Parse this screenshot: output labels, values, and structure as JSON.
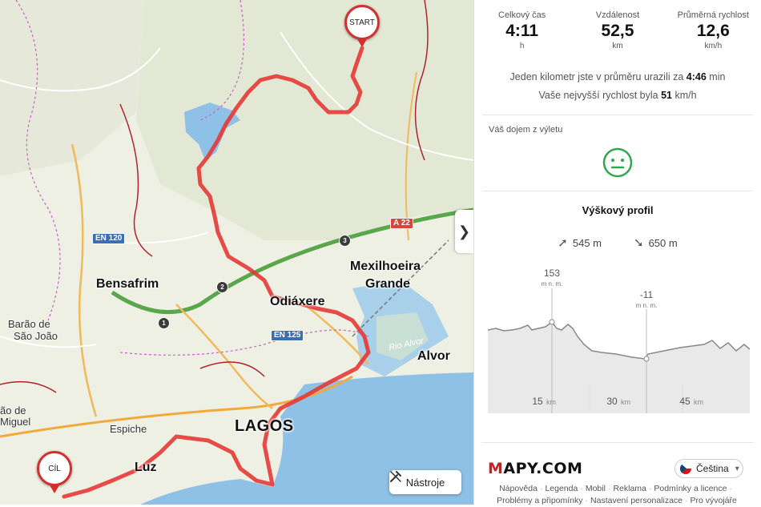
{
  "map": {
    "places": {
      "mexilhoeira_1": "Mexilhoeira",
      "mexilhoeira_2": "Grande",
      "bensafrim": "Bensafrim",
      "odiaxere": "Odiáxere",
      "alvor": "Alvor",
      "lagos": "LAGOS",
      "luz": "Luz",
      "espiche": "Espiche",
      "barao_1": "Barão de",
      "barao_2": "São João",
      "sao_miguel_1": "ão de",
      "sao_miguel_2": "Miguel",
      "rio_alvor": "Rio Alvor"
    },
    "road_shields": {
      "en120": "EN 120",
      "en125": "EN 125",
      "a22": "A 22"
    },
    "junctions": [
      "1",
      "2",
      "3"
    ],
    "start_label": "START",
    "finish_label": "CÍL",
    "tools_label": "Nástroje",
    "collapse_icon": "chevron-right-icon"
  },
  "stats": {
    "time": {
      "label": "Celkový čas",
      "value": "4:11",
      "unit": "h"
    },
    "distance": {
      "label": "Vzdálenost",
      "value": "52,5",
      "unit": "km"
    },
    "speed": {
      "label": "Průměrná rychlost",
      "value": "12,6",
      "unit": "km/h"
    }
  },
  "pace": {
    "line1_pre": "Jeden kilometr jste v průměru urazili za ",
    "line1_val": "4:46",
    "line1_post": " min",
    "line2_pre": "Vaše nejvyšší rychlost byla ",
    "line2_val": "51",
    "line2_post": " km/h"
  },
  "impression": {
    "label": "Váš dojem z výletu",
    "icon": "neutral-smiley-icon",
    "color": "#2fa84f"
  },
  "profile": {
    "title": "Výškový profil",
    "ascent": "545 m",
    "descent": "650 m",
    "max_value": "153",
    "max_unit": "m n. m.",
    "min_value": "-11",
    "min_unit": "m n. m.",
    "ticks": [
      {
        "value": "15",
        "unit": "km"
      },
      {
        "value": "30",
        "unit": "km"
      },
      {
        "value": "45",
        "unit": "km"
      }
    ]
  },
  "brand": {
    "logo_m": "M",
    "logo_rest": "APY.COM"
  },
  "language": {
    "label": "Čeština"
  },
  "footer": {
    "links": [
      "Nápověda",
      "Legenda",
      "Mobil",
      "Reklama",
      "Podmínky a licence",
      "Problémy a připomínky",
      "Nastavení personalizace",
      "Pro vývojáře"
    ]
  },
  "colors": {
    "route": "#e53935",
    "water": "#8fc1e6",
    "accent_red": "#d42e2e"
  }
}
